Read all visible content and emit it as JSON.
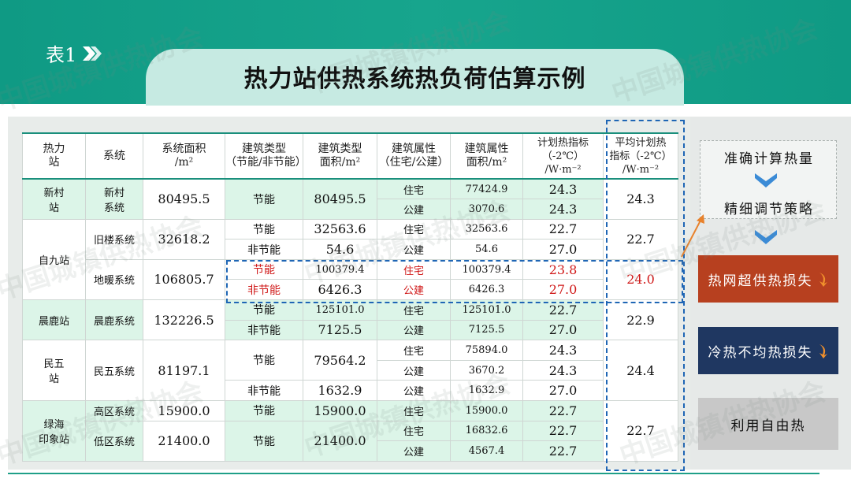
{
  "header": {
    "label": "表1",
    "title": "热力站供热系统热负荷估算示例"
  },
  "columns": [
    "热力\n站",
    "系统",
    "系统面积\n/m²",
    "建筑类型\n（节能/非节能）",
    "建筑类型\n面积/m²",
    "建筑属性\n（住宅/公建）",
    "建筑属性\n面积/m²",
    "计划热指标\n（-2℃）\n/W·m⁻²",
    "平均计划热\n指标（-2℃）\n/W·m⁻²"
  ],
  "rows": {
    "xincun": {
      "station": "新村\n站",
      "system": "新村\n系统",
      "area": "80495.5",
      "btype": "节能",
      "barea": "80495.5",
      "p1": "住宅",
      "pa1": "77424.9",
      "i1": "24.3",
      "p2": "公建",
      "pa2": "3070.6",
      "i2": "24.3",
      "avg": "24.3"
    },
    "jiulou": {
      "station": "自九站",
      "system": "旧楼系统",
      "area": "32618.2",
      "b1": "节能",
      "ba1": "32563.6",
      "p1": "住宅",
      "pa1": "32563.6",
      "i1": "22.7",
      "b2": "非节能",
      "ba2": "54.6",
      "p2": "公建",
      "pa2": "54.6",
      "i2": "27.0",
      "avg": "22.7"
    },
    "dinuan": {
      "system": "地暖系统",
      "area": "106805.7",
      "b1": "节能",
      "ba1": "100379.4",
      "p1": "住宅",
      "pa1": "100379.4",
      "i1": "23.8",
      "b2": "非节能",
      "ba2": "6426.3",
      "p2": "公建",
      "pa2": "6426.3",
      "i2": "27.0",
      "avg": "24.0"
    },
    "chenlu": {
      "station": "晨鹿站",
      "system": "晨鹿系统",
      "area": "132226.5",
      "b1": "节能",
      "ba1": "125101.0",
      "p1": "住宅",
      "pa1": "125101.0",
      "i1": "22.7",
      "b2": "非节能",
      "ba2": "7125.5",
      "p2": "公建",
      "pa2": "7125.5",
      "i2": "27.0",
      "avg": "22.9"
    },
    "minwu": {
      "station": "民五\n站",
      "system": "民五系统",
      "area": "81197.1",
      "b1": "节能",
      "ba1": "79564.2",
      "p1": "住宅",
      "pa1": "75894.0",
      "i1": "24.3",
      "p2": "公建",
      "pa2": "3670.2",
      "i2": "24.3",
      "b2": "非节能",
      "ba2": "1632.9",
      "p3": "公建",
      "pa3": "1632.9",
      "i3": "27.0",
      "avg": "24.4"
    },
    "lvhai": {
      "station": "绿海\n印象站",
      "gao": {
        "system": "高区系统",
        "area": "15900.0",
        "btype": "节能",
        "barea": "15900.0",
        "p1": "住宅",
        "pa1": "15900.0",
        "i1": "22.7"
      },
      "di": {
        "system": "低区系统",
        "area": "21400.0",
        "btype": "节能",
        "barea": "21400.0",
        "p1": "住宅",
        "pa1": "16832.6",
        "i1": "22.7",
        "p2": "公建",
        "pa2": "4567.4",
        "i2": "22.7"
      },
      "avg": "22.7"
    }
  },
  "side": {
    "s1": "准确计算热量",
    "s2": "精细调节策略",
    "b1": "热网超供热损失",
    "b2": "冷热不均热损失",
    "b3": "利用自由热"
  },
  "watermark": "中国城镇供热协会",
  "colors": {
    "teal": "#17a58d",
    "red_box": "#b7401f",
    "navy_box": "#1f3761",
    "grey_box": "#c8c8c8",
    "dash_blue": "#1f66b5",
    "highlight_red": "#d01818"
  }
}
